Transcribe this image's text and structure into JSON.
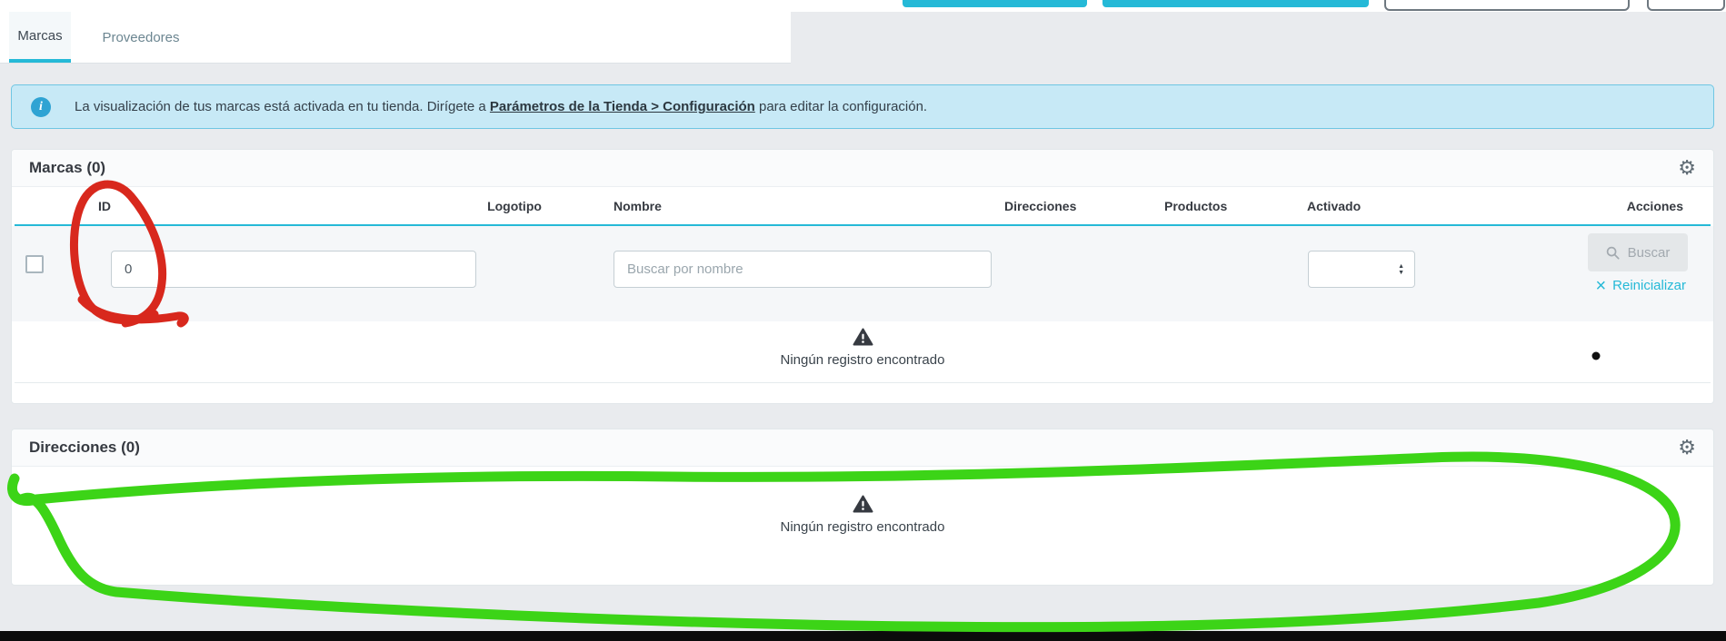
{
  "tabs": [
    {
      "label": "Marcas",
      "active": true
    },
    {
      "label": "Proveedores",
      "active": false
    }
  ],
  "alert": {
    "text_before": "La visualización de tus marcas está activada en tu tienda. Dirígete a ",
    "link": "Parámetros de la Tienda > Configuración",
    "text_after": " para editar la configuración."
  },
  "brands": {
    "title": "Marcas (0)",
    "columns": [
      "ID",
      "Logotipo",
      "Nombre",
      "Direcciones",
      "Productos",
      "Activado",
      "Acciones"
    ],
    "filters": {
      "id_value": "0",
      "name_placeholder": "Buscar por nombre",
      "search_label": "Buscar",
      "reset_label": "Reinicializar"
    },
    "empty_text": "Ningún registro encontrado"
  },
  "addresses": {
    "title": "Direcciones (0)",
    "empty_text": "Ningún registro encontrado"
  },
  "icons": {
    "gear": "⚙",
    "close": "×",
    "info": "i",
    "caret_up": "▲",
    "caret_down": "▼"
  },
  "colors": {
    "accent_teal": "#25b9d7",
    "alert_bg": "#c7e9f6",
    "annotation_red": "#d8281d",
    "annotation_green": "#3cd417"
  }
}
